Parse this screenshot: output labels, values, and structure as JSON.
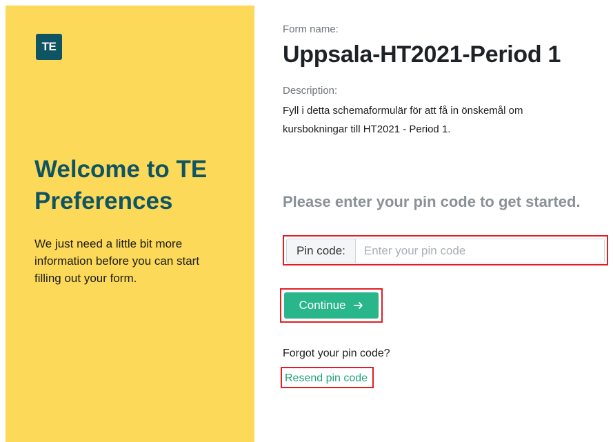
{
  "sidebar": {
    "logo_text": "TE",
    "title": "Welcome to TE Preferences",
    "message": "We just need a little bit more information before you can start filling out your form.",
    "background_color": "#fcd958",
    "accent_color": "#0f5463"
  },
  "form": {
    "name_label": "Form name:",
    "name": "Uppsala-HT2021-Period 1",
    "description_label": "Description:",
    "description": "Fyll i detta schemaformulär för att få in önskemål om kursbokningar till HT2021 - Period 1."
  },
  "pin": {
    "prompt": "Please enter your pin code to get started.",
    "label": "Pin code:",
    "value": "",
    "placeholder": "Enter your pin code"
  },
  "actions": {
    "continue_label": "Continue",
    "continue_icon": "arrow-right-icon",
    "button_color": "#29b68a",
    "forgot_text": "Forgot your pin code?",
    "resend_label": "Resend pin code"
  }
}
